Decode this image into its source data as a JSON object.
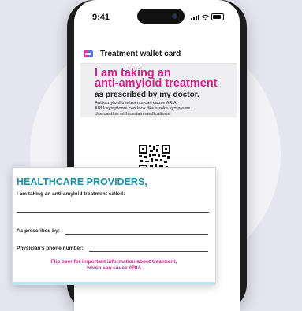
{
  "status_bar": {
    "time": "9:41"
  },
  "wallet_card": {
    "title": "Treatment wallet card",
    "headline_1": "I am taking an",
    "headline_2": "anti-amyloid treatment",
    "prescribed": "as prescribed by my doctor.",
    "note_1": "Anti-amyloid treatments can cause ARIA.",
    "note_2": "ARIA symptoms can look like stroke symptoms.",
    "note_3": "Use caution with certain medications."
  },
  "provider_card": {
    "title": "HEALTHCARE PROVIDERS,",
    "intro": "I am taking an anti-amyloid treatment called:",
    "prescribed_by_label": "As prescribed by:",
    "phone_label": "Physician’s phone number:",
    "flip_1": "Flip over for important information about treatment,",
    "flip_2": "which can cause ARIA"
  },
  "colors": {
    "accent_magenta": "#d61f8c",
    "accent_teal": "#1f8fa8"
  },
  "icons": [
    "wallet-card-icon",
    "qr-code",
    "signal-icon",
    "wifi-icon",
    "battery-icon"
  ]
}
